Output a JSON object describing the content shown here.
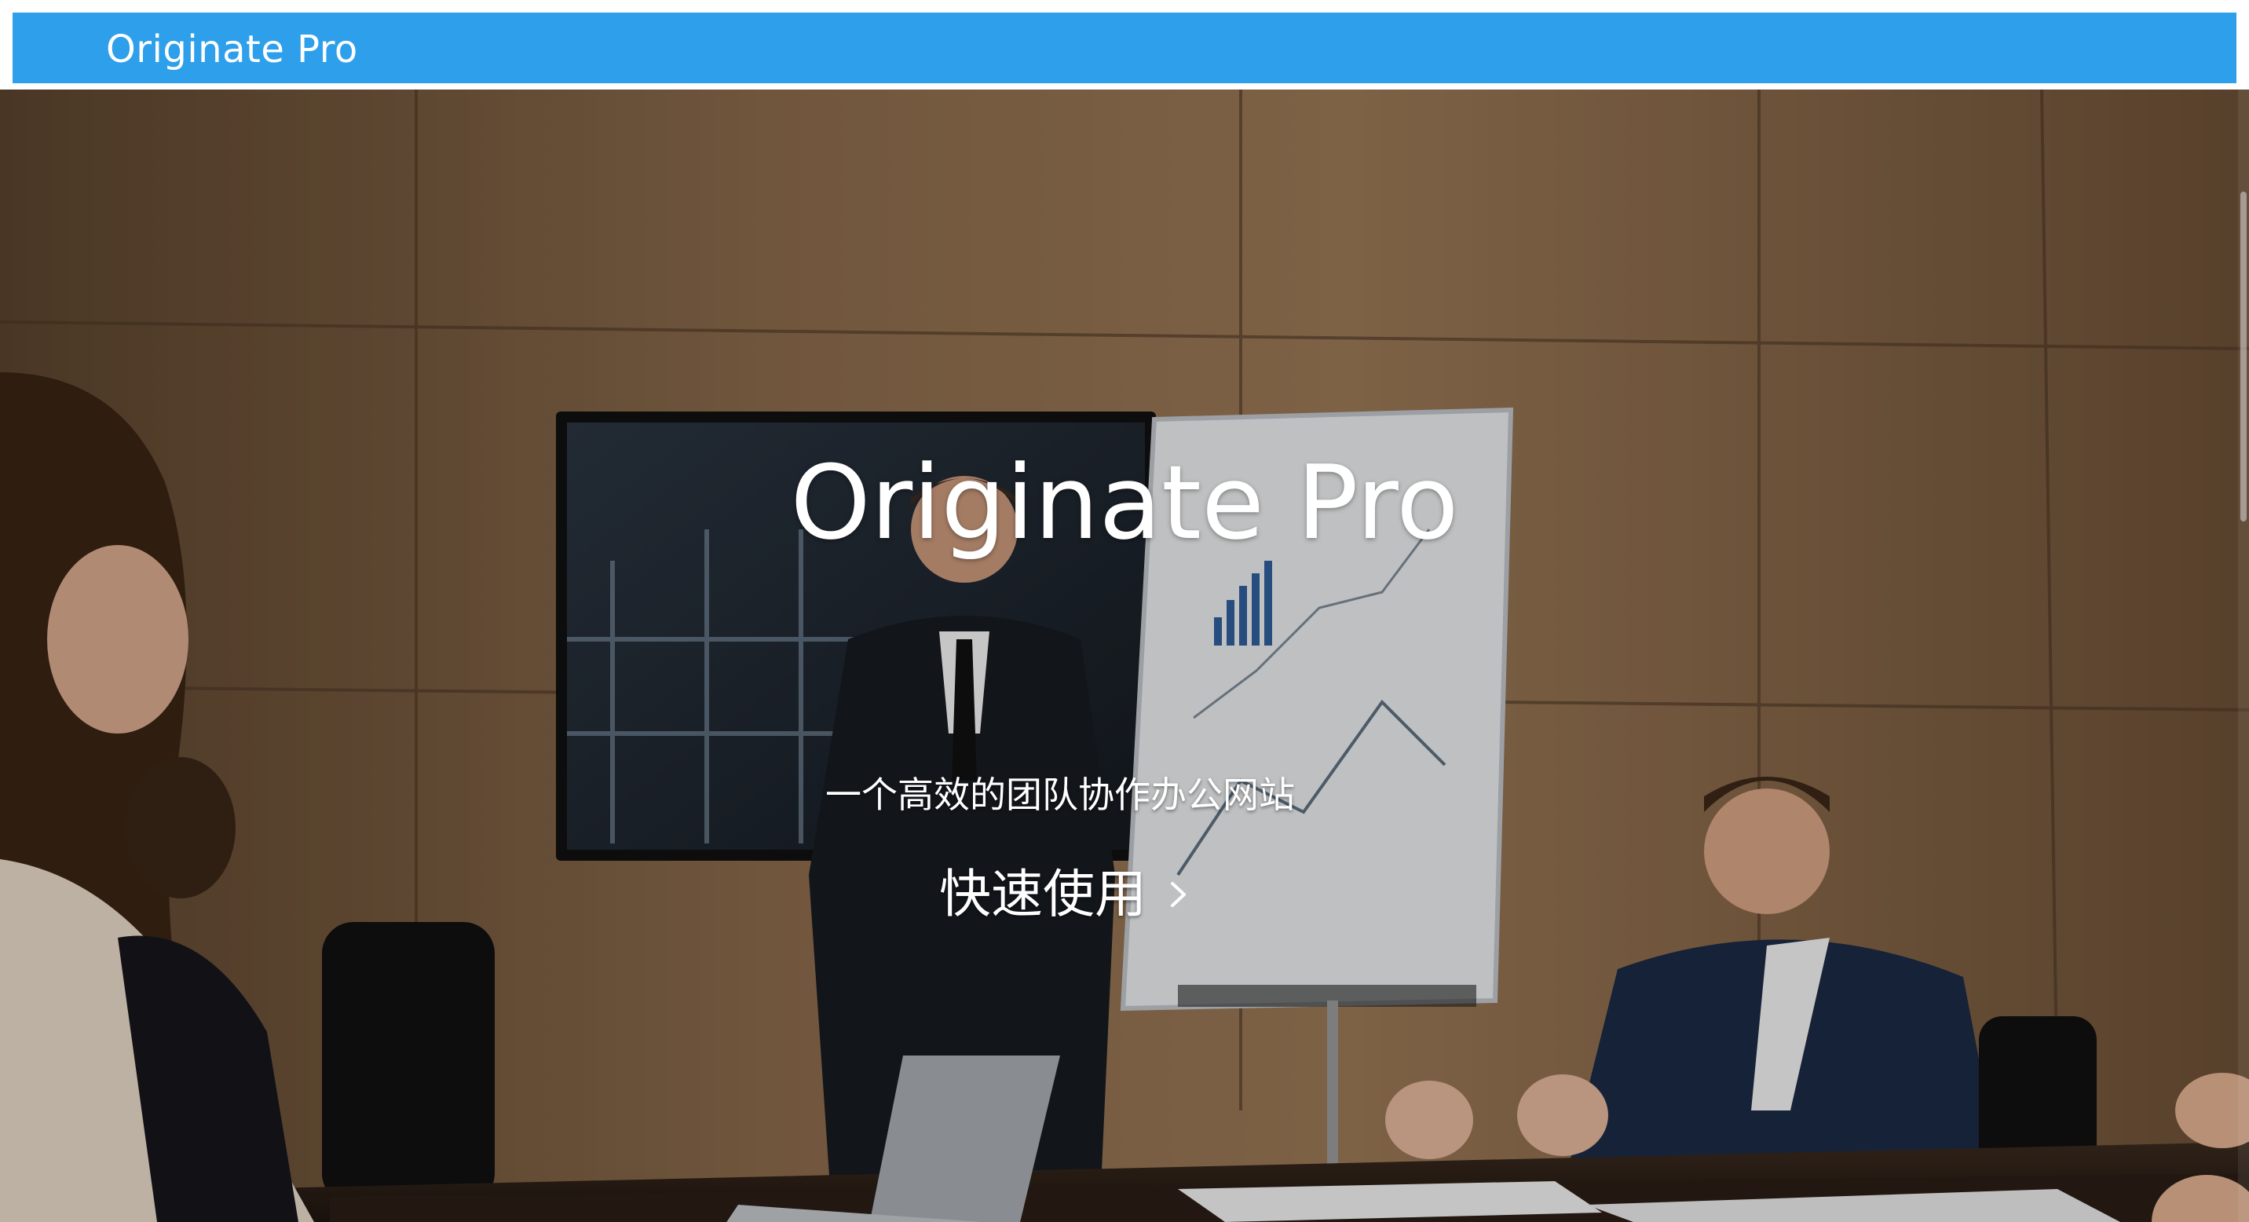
{
  "navbar": {
    "brand": "Originate Pro",
    "background_color": "#2e9fea"
  },
  "hero": {
    "title": "Originate Pro",
    "subtitle": "一个高效的团队协作办公网站",
    "cta_label": "快速使用",
    "cta_icon": "chevron-right-icon",
    "background_image": "business meeting in conference room"
  }
}
